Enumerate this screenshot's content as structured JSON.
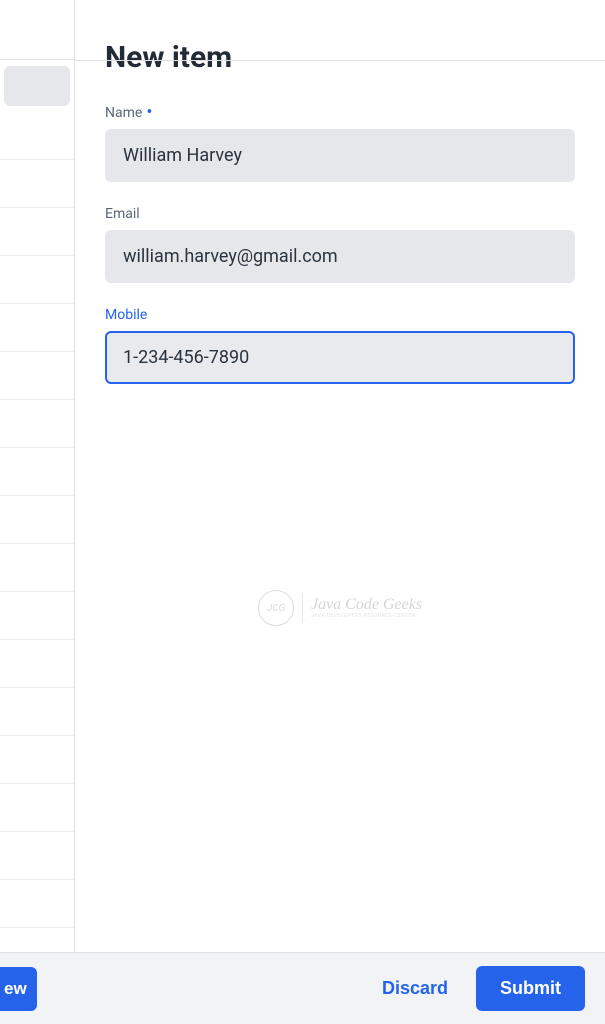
{
  "title": "New item",
  "form": {
    "name": {
      "label": "Name",
      "required": true,
      "value": "William Harvey"
    },
    "email": {
      "label": "Email",
      "value": "william.harvey@gmail.com"
    },
    "mobile": {
      "label": "Mobile",
      "value": "1-234-456-7890",
      "focused": true
    }
  },
  "watermark": {
    "circle_text": "JCG",
    "main": "Java Code Geeks",
    "sub": "Java Developers Resource Center"
  },
  "buttons": {
    "left_fragment": "ew",
    "discard": "Discard",
    "submit": "Submit"
  }
}
